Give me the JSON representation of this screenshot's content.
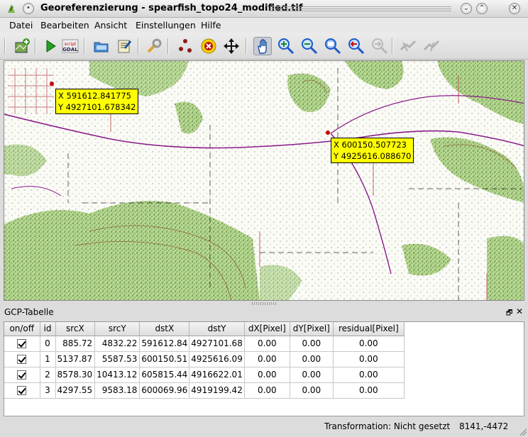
{
  "window": {
    "title": "Georeferenzierung - spearfish_topo24_modified.tif"
  },
  "menu": [
    "Datei",
    "Bearbeiten",
    "Ansicht",
    "Einstellungen",
    "Hilfe"
  ],
  "toolbar": {
    "script_label": "script",
    "gdal_label": "GDAL",
    "icons": [
      "open-raster-icon",
      "start-georeferencing-icon",
      "generate-gdal-script-icon",
      "load-gcp-icon",
      "save-gcp-icon",
      "transformation-settings-icon",
      "add-point-icon",
      "delete-point-icon",
      "move-point-icon",
      "pan-icon",
      "zoom-in-icon",
      "zoom-out-icon",
      "zoom-to-layer-icon",
      "zoom-last-icon",
      "zoom-next-icon",
      "link-georef-to-qgis-icon",
      "link-qgis-to-georef-icon"
    ]
  },
  "map": {
    "gcp_points": [
      {
        "x_label": "X 591612.841775",
        "y_label": "Y 4927101.678342"
      },
      {
        "x_label": "X 600150.507723",
        "y_label": "Y 4925616.088670"
      }
    ],
    "colors": {
      "vegetation": "#b5d88f",
      "road": "#8a1c8a",
      "contour": "#8b3a1a",
      "marker": "#cc0000",
      "label_bg": "#ffff00"
    }
  },
  "gcp_panel": {
    "title": "GCP-Tabelle",
    "float_glyph": "🗗",
    "close_glyph": "✕",
    "columns": [
      "on/off",
      "id",
      "srcX",
      "srcY",
      "dstX",
      "dstY",
      "dX[Pixel]",
      "dY[Pixel]",
      "residual[Pixel]"
    ],
    "rows": [
      {
        "enabled": true,
        "id": "0",
        "srcX": "885.72",
        "srcY": "4832.22",
        "dstX": "591612.84",
        "dstY": "4927101.68",
        "dX": "0.00",
        "dY": "0.00",
        "residual": "0.00"
      },
      {
        "enabled": true,
        "id": "1",
        "srcX": "5137.87",
        "srcY": "5587.53",
        "dstX": "600150.51",
        "dstY": "4925616.09",
        "dX": "0.00",
        "dY": "0.00",
        "residual": "0.00"
      },
      {
        "enabled": true,
        "id": "2",
        "srcX": "8578.30",
        "srcY": "10413.12",
        "dstX": "605815.44",
        "dstY": "4916622.01",
        "dX": "0.00",
        "dY": "0.00",
        "residual": "0.00"
      },
      {
        "enabled": true,
        "id": "3",
        "srcX": "4297.55",
        "srcY": "9583.18",
        "dstX": "600069.96",
        "dstY": "4919199.42",
        "dX": "0.00",
        "dY": "0.00",
        "residual": "0.00"
      }
    ]
  },
  "status": {
    "transformation": "Transformation: Nicht gesetzt",
    "coordinates": "8141,-4472"
  }
}
